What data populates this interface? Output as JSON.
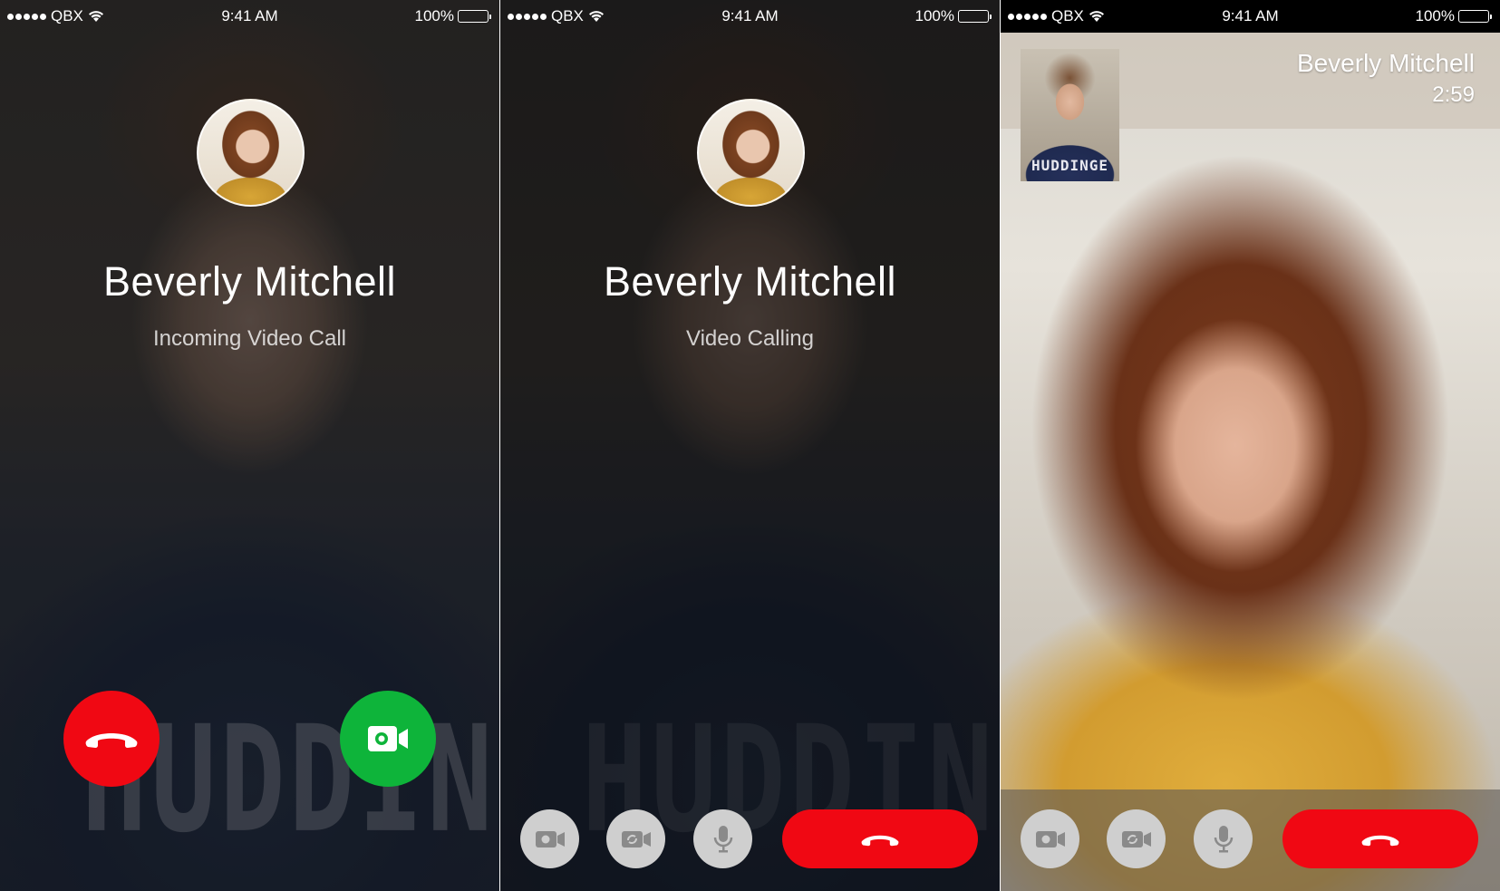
{
  "status_bar": {
    "carrier": "QBX",
    "time": "9:41 AM",
    "battery": "100%"
  },
  "screens": [
    {
      "caller_name": "Beverly Mitchell",
      "call_status": "Incoming Video Call",
      "background_text": "HUDDINGE"
    },
    {
      "caller_name": "Beverly Mitchell",
      "call_status": "Video Calling",
      "background_text": "HUDDINGE"
    },
    {
      "caller_name": "Beverly Mitchell",
      "call_timer": "2:59",
      "pip_text": "HUDDINGE"
    }
  ],
  "colors": {
    "decline_red": "#f00813",
    "accept_green": "#0eb43a",
    "control_grey": "#cfcfcf"
  },
  "icons": {
    "decline": "phone-hangup-icon",
    "accept": "video-camera-icon",
    "toggle_camera": "camera-icon",
    "switch_camera": "switch-camera-icon",
    "mute": "microphone-icon",
    "end_call": "phone-hangup-icon"
  }
}
